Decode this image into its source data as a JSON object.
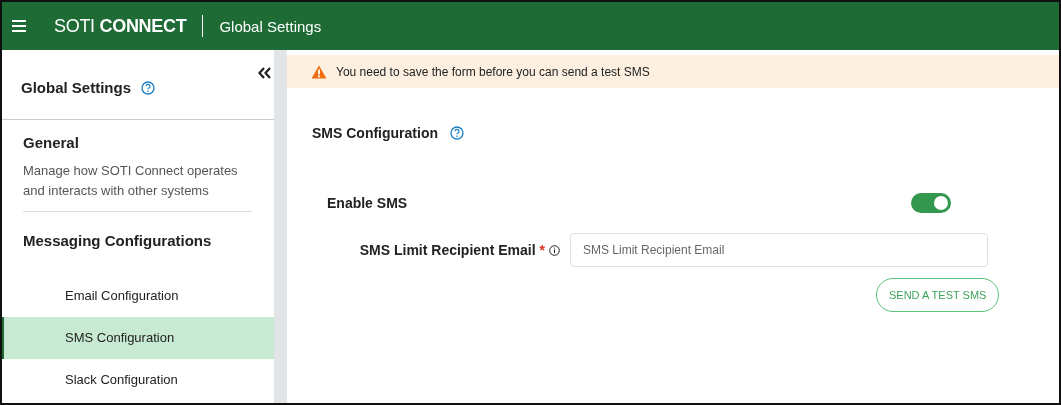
{
  "header": {
    "brand_light": "SOTI",
    "brand_bold": "CONNECT",
    "title": "Global Settings"
  },
  "sidebar": {
    "title": "Global Settings",
    "sections": [
      {
        "heading": "General",
        "description": "Manage how SOTI Connect operates and interacts with other systems"
      },
      {
        "heading": "Messaging Configurations",
        "items": [
          {
            "label": "Email Configuration",
            "selected": false
          },
          {
            "label": "SMS Configuration",
            "selected": true
          },
          {
            "label": "Slack Configuration",
            "selected": false
          }
        ]
      }
    ]
  },
  "alert": {
    "message": "You need to save the form before you can send a test SMS"
  },
  "form": {
    "title": "SMS Configuration",
    "toggle": {
      "label": "Enable SMS",
      "on": true
    },
    "field": {
      "label": "SMS Limit Recipient Email",
      "required_mark": "*",
      "placeholder": "SMS Limit Recipient Email"
    },
    "button": "SEND A TEST SMS"
  }
}
